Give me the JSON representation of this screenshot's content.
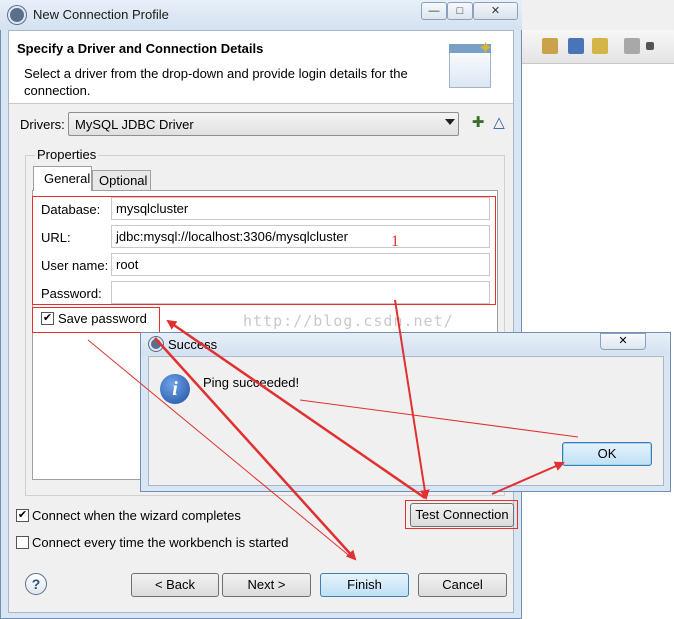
{
  "window": {
    "title": "New Connection Profile",
    "minimize": "—",
    "maximize": "□",
    "close": "✕"
  },
  "banner": {
    "title": "Specify a Driver and Connection Details",
    "description": "Select a driver from the drop-down and provide login details for the connection."
  },
  "drivers": {
    "label": "Drivers:",
    "selected": "MySQL JDBC Driver",
    "new_icon": "new-driver-icon",
    "edit_icon": "edit-driver-icon"
  },
  "properties": {
    "label": "Properties",
    "tabs": [
      {
        "label": "General",
        "active": true
      },
      {
        "label": "Optional",
        "active": false
      }
    ],
    "fields": [
      {
        "label": "Database:",
        "value": "mysqlcluster"
      },
      {
        "label": "URL:",
        "value": "jdbc:mysql://localhost:3306/mysqlcluster"
      },
      {
        "label": "User name:",
        "value": "root"
      },
      {
        "label": "Password:",
        "value": ""
      }
    ],
    "save_password": {
      "label": "Save password",
      "checked": true
    }
  },
  "options": {
    "connect_when_complete": {
      "label": "Connect when the wizard completes",
      "checked": true
    },
    "connect_every_time": {
      "label": "Connect every time the workbench is started",
      "checked": false
    },
    "test_connection": "Test Connection"
  },
  "footer": {
    "back": "< Back",
    "next": "Next >",
    "finish": "Finish",
    "cancel": "Cancel",
    "help_icon": "help-icon"
  },
  "success_dialog": {
    "title": "Success",
    "message": "Ping succeeded!",
    "ok": "OK",
    "close": "✕",
    "icon": "info-icon"
  },
  "annotations": {
    "marker": "1",
    "watermark": "http://blog.csdn.net/"
  },
  "colors": {
    "annotation_red": "#e03030",
    "accent_blue": "#3c7fb1",
    "title_bar": "#d9e5f3"
  }
}
